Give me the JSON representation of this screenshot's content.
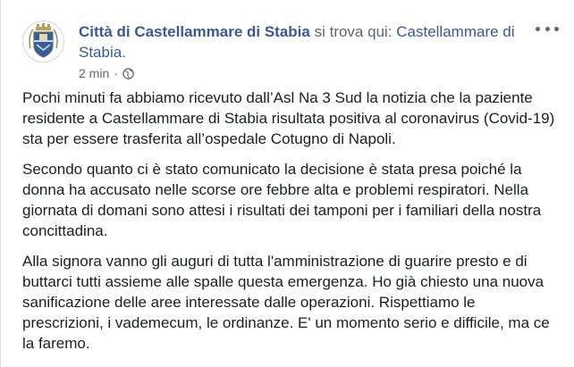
{
  "post": {
    "page_name": "Città di Castellammare di Stabia",
    "location_connector": " si trova qui: ",
    "location": "Castellammare di Stabia.",
    "timestamp": "2 min",
    "separator": "·",
    "audience_icon": "globe-icon",
    "more_icon": "more-options-icon",
    "paragraphs": [
      "Pochi minuti fa abbiamo ricevuto dall’Asl Na 3 Sud la notizia che la paziente residente a Castellammare di Stabia risultata positiva al coronavirus (Covid-19) sta per essere trasferita all’ospedale Cotugno di Napoli.",
      "Secondo quanto ci è stato comunicato la decisione è stata presa poiché la donna ha accusato nelle scorse ore febbre alta e problemi respiratori. Nella giornata di domani sono attesi i risultati dei tamponi per i familiari della nostra concittadina.",
      "Alla signora vanno gli auguri di tutta l'amministrazione di guarire presto e di buttarci tutti assieme alle spalle questa emergenza. Ho già chiesto una nuova sanificazione delle aree interessate dalle operazioni. Rispettiamo le prescrizioni, i vademecum, le ordinanze. E' un momento serio e difficile, ma ce la faremo."
    ]
  },
  "colors": {
    "link": "#385898",
    "secondary_text": "#616770",
    "body_text": "#1c1e21"
  }
}
